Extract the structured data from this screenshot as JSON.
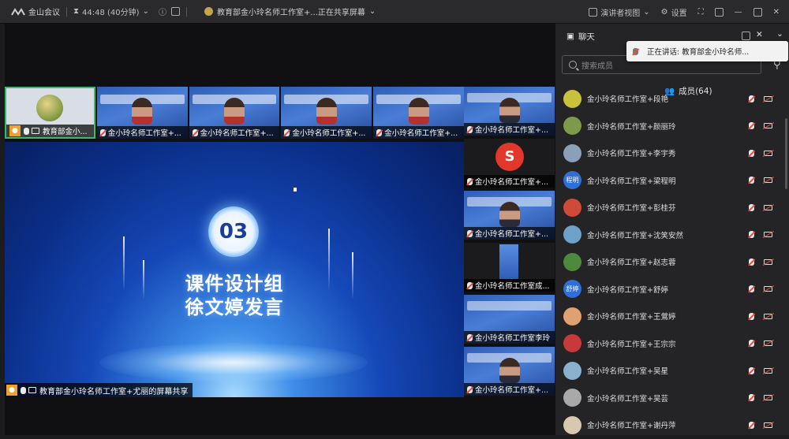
{
  "topbar": {
    "app_name": "金山会议",
    "timer": "44:48 (40分钟)",
    "meeting_title": "教育部金小玲名师工作室+...正在共享屏幕",
    "presenter_view": "演讲者视图",
    "settings": "设置"
  },
  "thumbs": [
    {
      "name": "教育部金小...",
      "active": true
    },
    {
      "name": "金小玲名师工作室+..."
    },
    {
      "name": "金小玲名师工作室+..."
    },
    {
      "name": "金小玲名师工作室+..."
    },
    {
      "name": "金小玲名师工作室+..."
    }
  ],
  "side_tiles": [
    {
      "name": "金小玲名师工作室+...",
      "style": "video"
    },
    {
      "name": "金小玲名师工作室+...",
      "style": "seal"
    },
    {
      "name": "金小玲名师工作室+...",
      "style": "video"
    },
    {
      "name": "金小玲名师工作室成...",
      "style": "phone"
    },
    {
      "name": "金小玲名师工作室李玲",
      "style": "video"
    },
    {
      "name": "金小玲名师工作室+...",
      "style": "video"
    }
  ],
  "stage": {
    "number": "03",
    "line1": "课件设计组",
    "line2": "徐文婷发言",
    "share_label": "教育部金小玲名师工作室+尤丽的屏幕共享"
  },
  "panel": {
    "chat_tab": "聊天",
    "members_tab": "成员(64)",
    "speaking": "正在讲话: 教育部金小玲名师...",
    "search_placeholder": "搜索成员"
  },
  "members": [
    {
      "name": "金小玲名师工作室+段艳",
      "avatar": "#c9c13a"
    },
    {
      "name": "金小玲名师工作室+颜丽玲",
      "avatar": "#7c9a4a"
    },
    {
      "name": "金小玲名师工作室+李宇秀",
      "avatar": "#8aa0b8"
    },
    {
      "name": "金小玲名师工作室+梁程明",
      "avatar": "#2f6fd8",
      "initials": "程明"
    },
    {
      "name": "金小玲名师工作室+彭桂芬",
      "avatar": "#d04a3a"
    },
    {
      "name": "金小玲名师工作室+沈笑安然",
      "avatar": "#6fa0c8"
    },
    {
      "name": "金小玲名师工作室+赵志蓉",
      "avatar": "#4d8a3e"
    },
    {
      "name": "金小玲名师工作室+舒婷",
      "avatar": "#2f6fd8",
      "initials": "舒婷"
    },
    {
      "name": "金小玲名师工作室+王鶯婷",
      "avatar": "#e0a070"
    },
    {
      "name": "金小玲名师工作室+王宗宗",
      "avatar": "#c83a3a"
    },
    {
      "name": "金小玲名师工作室+吴星",
      "avatar": "#8ab0d0"
    },
    {
      "name": "金小玲名师工作室+吴芸",
      "avatar": "#a8a8a8"
    },
    {
      "name": "金小玲名师工作室+谢丹萍",
      "avatar": "#d8c8b0"
    }
  ]
}
